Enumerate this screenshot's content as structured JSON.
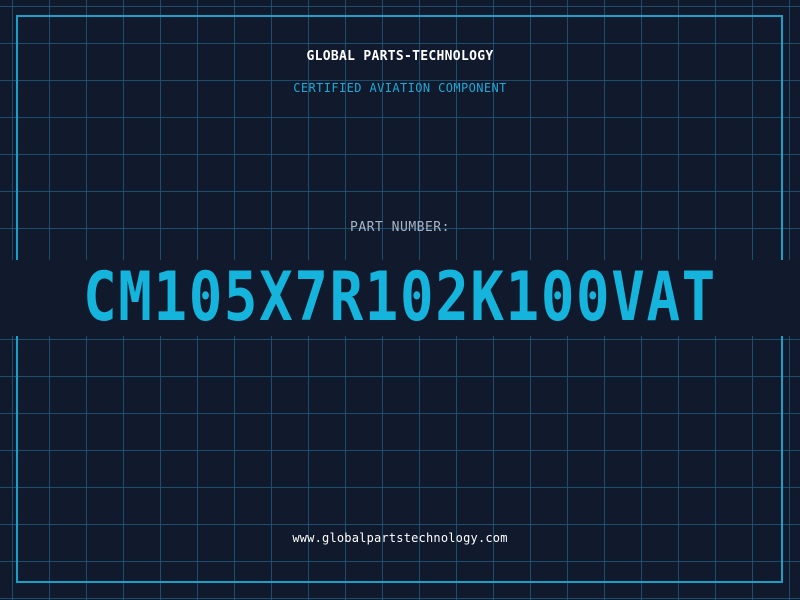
{
  "header": {
    "company": "GLOBAL PARTS-TECHNOLOGY",
    "subtitle": "CERTIFIED AVIATION COMPONENT"
  },
  "part": {
    "label": "PART NUMBER:",
    "number": "CM105X7R102K100VAT"
  },
  "footer": {
    "website": "www.globalpartstechnology.com"
  },
  "colors": {
    "background": "#111a2d",
    "grid": "#1e5676",
    "frame": "#1a9fc6",
    "accent": "#14b4dc",
    "title": "#ffffff",
    "label": "#a8b4c4"
  }
}
